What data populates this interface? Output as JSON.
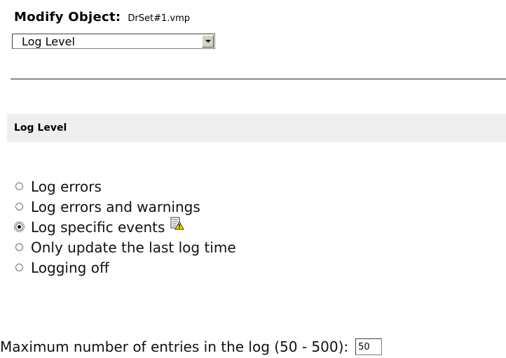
{
  "header": {
    "label": "Modify Object:",
    "object_name": "DrSet#1.vmp"
  },
  "view_select": {
    "value": "Log Level"
  },
  "section": {
    "title": "Log Level"
  },
  "options": [
    {
      "label": "Log errors",
      "checked": false
    },
    {
      "label": "Log errors and warnings",
      "checked": false
    },
    {
      "label": "Log specific events",
      "checked": true,
      "icon": "log-events-settings-icon"
    },
    {
      "label": "Only update the last log time",
      "checked": false
    },
    {
      "label": "Logging off",
      "checked": false
    }
  ],
  "max_entries": {
    "label": "Maximum number of entries in the log (50 - 500):",
    "value": "50"
  },
  "colors": {
    "section_bg": "#efefef",
    "rule": "#888888"
  }
}
